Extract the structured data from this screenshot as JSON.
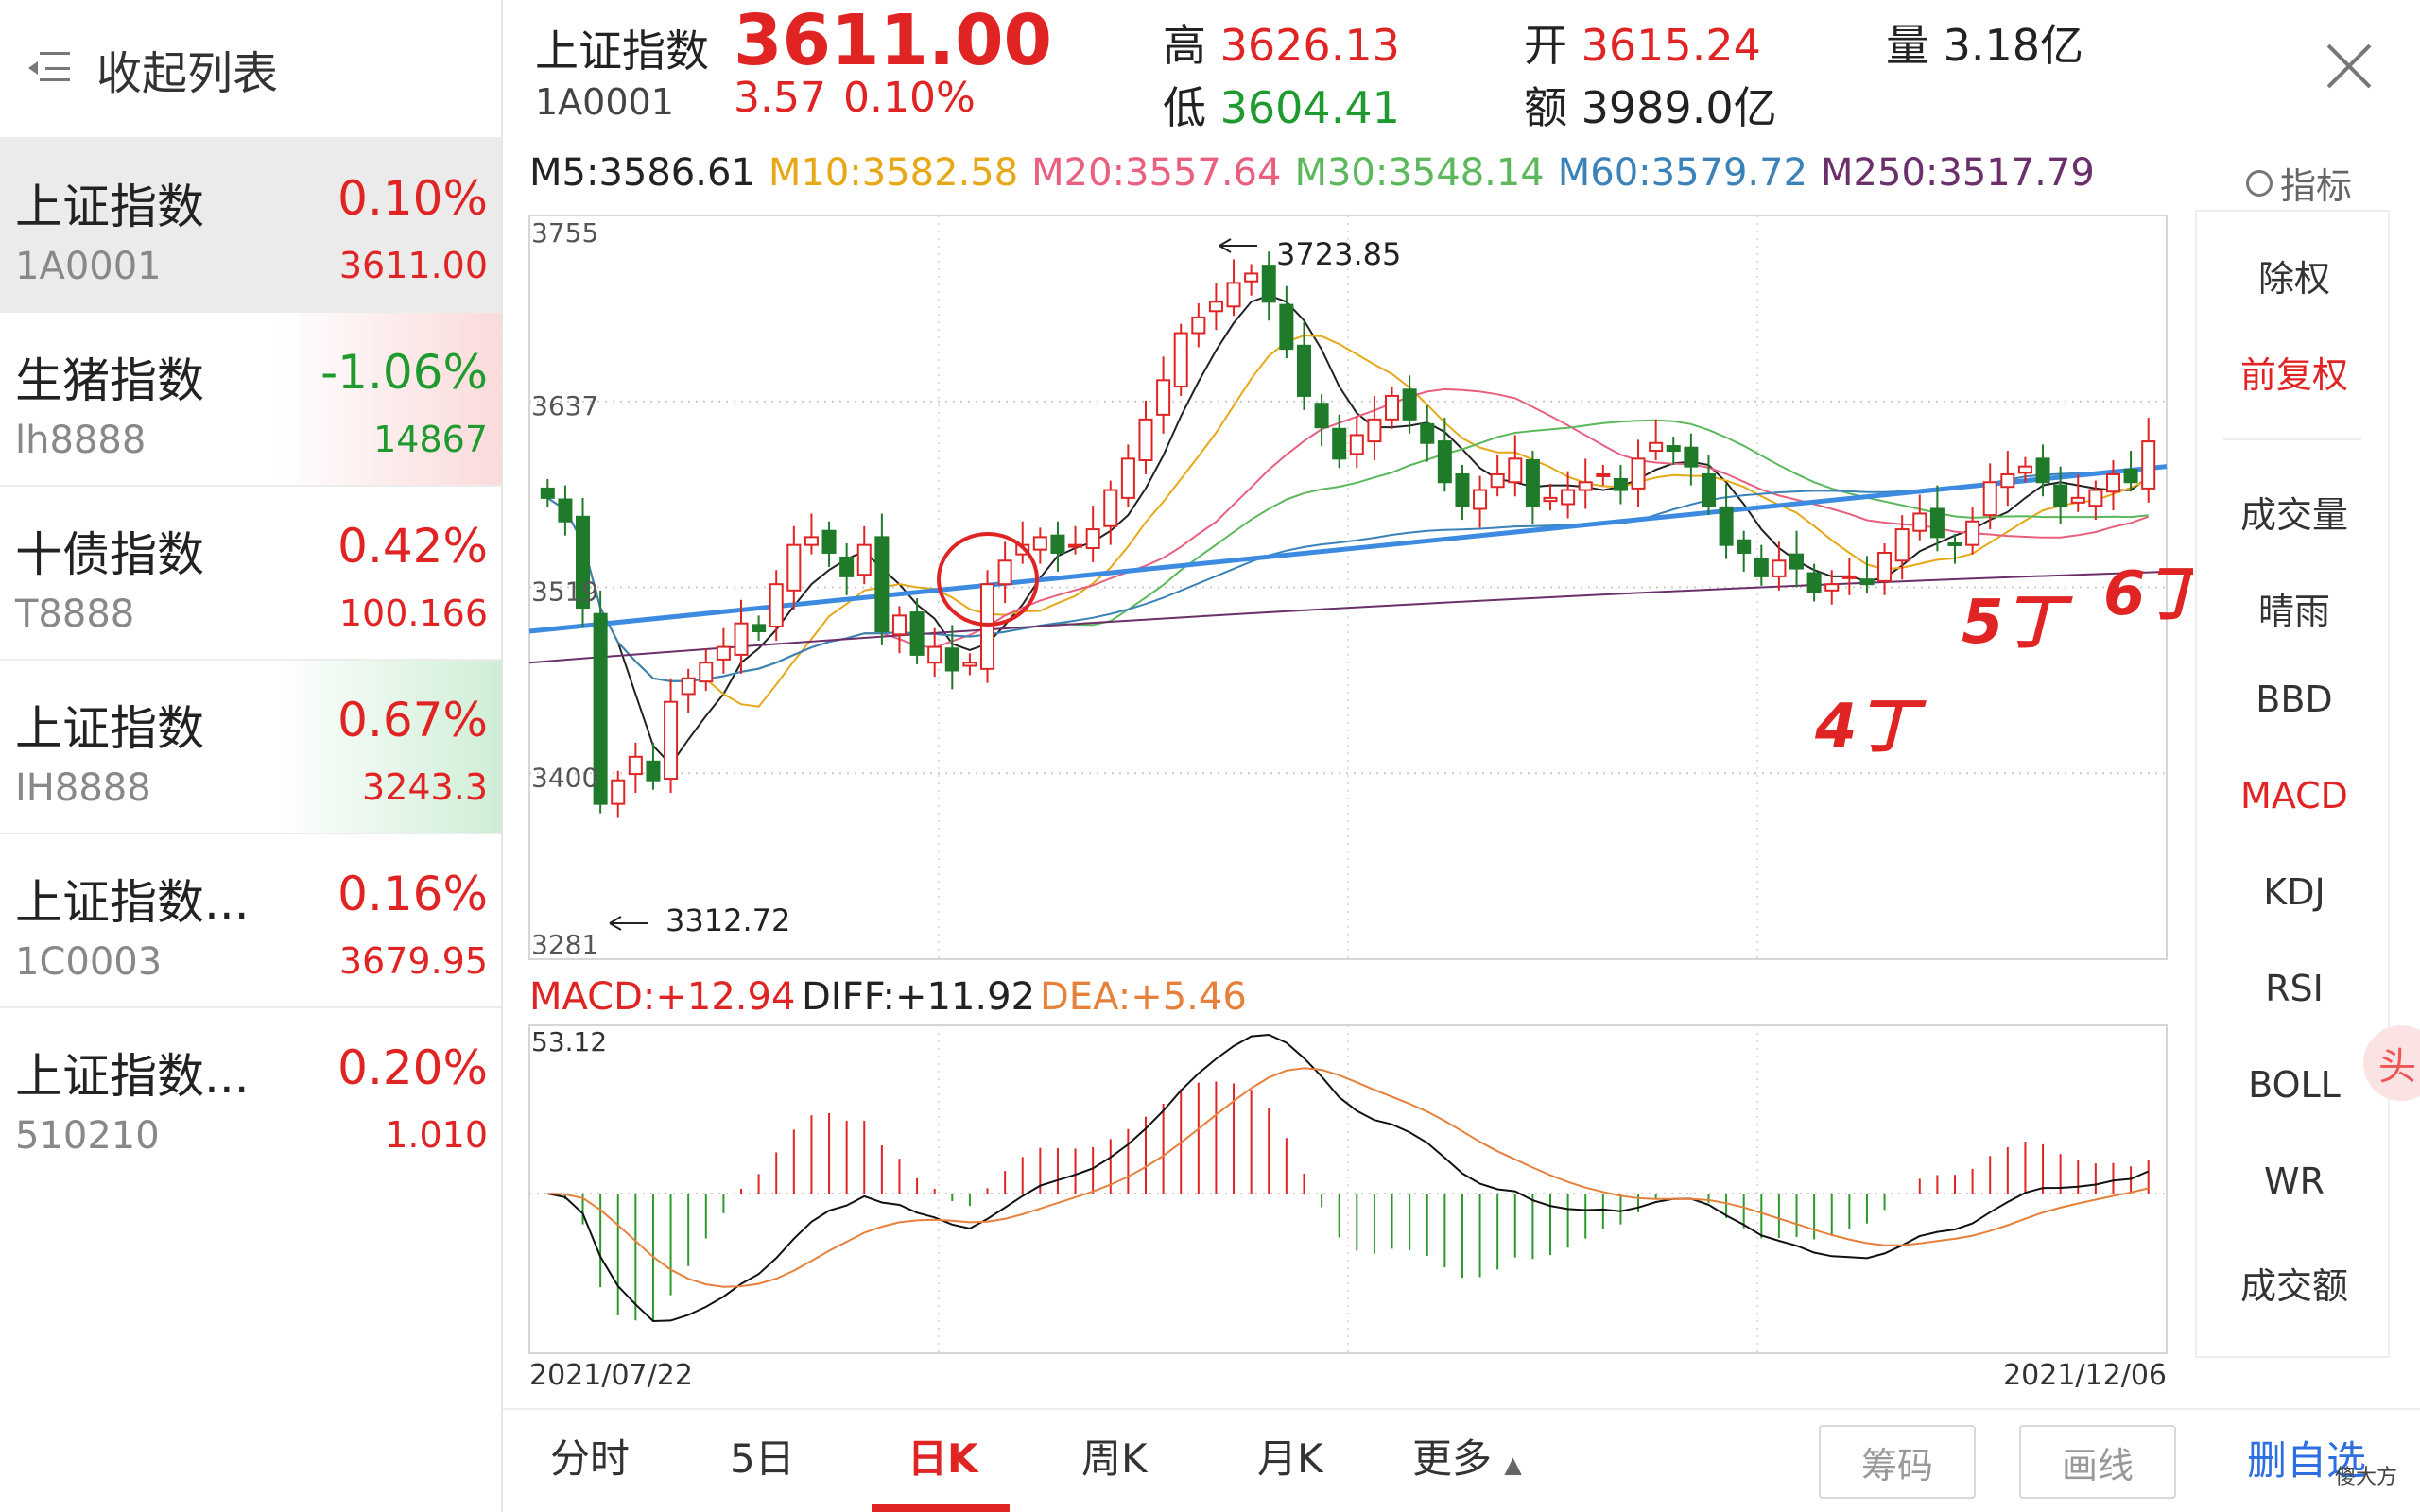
{
  "sidebar": {
    "collapse_label": "收起列表",
    "items": [
      {
        "name": "上证指数",
        "code": "1A0001",
        "pct": "0.10%",
        "price": "3611.00",
        "dir": "up",
        "bg": "#ebebeb"
      },
      {
        "name": "生猪指数",
        "code": "lh8888",
        "pct": "-1.06%",
        "price": "14867",
        "dir": "down",
        "bg": "grad-red"
      },
      {
        "name": "十债指数",
        "code": "T8888",
        "pct": "0.42%",
        "price": "100.166",
        "dir": "up",
        "bg": "#ffffff"
      },
      {
        "name": "上证指数",
        "code": "IH8888",
        "pct": "0.67%",
        "price": "3243.3",
        "dir": "up",
        "bg": "grad-green"
      },
      {
        "name": "上证指数...",
        "code": "1C0003",
        "pct": "0.16%",
        "price": "3679.95",
        "dir": "up",
        "bg": "#ffffff"
      },
      {
        "name": "上证指数...",
        "code": "510210",
        "pct": "0.20%",
        "price": "1.010",
        "dir": "up",
        "bg": "#ffffff"
      }
    ]
  },
  "header": {
    "name": "上证指数",
    "code": "1A0001",
    "price": "3611.00",
    "change": "3.57",
    "change_pct": "0.10%",
    "high_label": "高",
    "high": "3626.13",
    "low_label": "低",
    "low": "3604.41",
    "open_label": "开",
    "open": "3615.24",
    "amount_label": "额",
    "amount": "3989.0亿",
    "volume_label": "量",
    "volume": "3.18亿"
  },
  "ma_row": [
    {
      "text": "M5:3586.61",
      "color": "#222222"
    },
    {
      "text": "M10:3582.58",
      "color": "#e6a817"
    },
    {
      "text": "M20:3557.64",
      "color": "#e8607e"
    },
    {
      "text": "M30:3548.14",
      "color": "#5cb85c"
    },
    {
      "text": "M60:3579.72",
      "color": "#3b82b8"
    },
    {
      "text": "M250:3517.79",
      "color": "#6b2f6b"
    }
  ],
  "indicator_button": "指标",
  "right_menu": [
    {
      "label": "除权",
      "active": false
    },
    {
      "label": "前复权",
      "active": true
    },
    {
      "label": "成交量",
      "active": false
    },
    {
      "label": "晴雨",
      "active": false
    },
    {
      "label": "BBD",
      "active": false
    },
    {
      "label": "MACD",
      "active": true
    },
    {
      "label": "KDJ",
      "active": false
    },
    {
      "label": "RSI",
      "active": false
    },
    {
      "label": "BOLL",
      "active": false
    },
    {
      "label": "WR",
      "active": false
    },
    {
      "label": "成交额",
      "active": false
    }
  ],
  "macd_row": [
    {
      "text": "MACD:+12.94",
      "color": "#e02424"
    },
    {
      "text": "DIFF:+11.92",
      "color": "#222222"
    },
    {
      "text": "DEA:+5.46",
      "color": "#e6803a"
    }
  ],
  "annotations": {
    "low_4": "4丁",
    "low_5": "5丁",
    "low_6": "6丁"
  },
  "chart_data": {
    "type": "candlestick",
    "y_axis_labels": [
      "3755",
      "3637",
      "3519",
      "3400",
      "3281"
    ],
    "ylim": [
      3281,
      3755
    ],
    "x_start_label": "2021/07/22",
    "x_end_label": "2021/12/06",
    "max_label": "3723.85",
    "min_label": "3312.72",
    "macd_top_label": "53.12",
    "close_series": [
      3575,
      3560,
      3505,
      3380,
      3395,
      3410,
      3395,
      3445,
      3460,
      3470,
      3480,
      3495,
      3490,
      3520,
      3545,
      3550,
      3540,
      3525,
      3545,
      3490,
      3500,
      3475,
      3480,
      3465,
      3470,
      3520,
      3535,
      3545,
      3550,
      3540,
      3545,
      3555,
      3580,
      3600,
      3625,
      3650,
      3680,
      3690,
      3700,
      3712,
      3718,
      3700,
      3670,
      3640,
      3620,
      3600,
      3615,
      3625,
      3640,
      3625,
      3610,
      3585,
      3570,
      3580,
      3590,
      3600,
      3570,
      3575,
      3580,
      3585,
      3590,
      3580,
      3600,
      3610,
      3605,
      3595,
      3570,
      3545,
      3540,
      3525,
      3535,
      3530,
      3515,
      3520,
      3525,
      3520,
      3540,
      3555,
      3565,
      3550,
      3545,
      3560,
      3585,
      3590,
      3595,
      3585,
      3570,
      3575,
      3580,
      3590,
      3585,
      3611
    ]
  }
}
